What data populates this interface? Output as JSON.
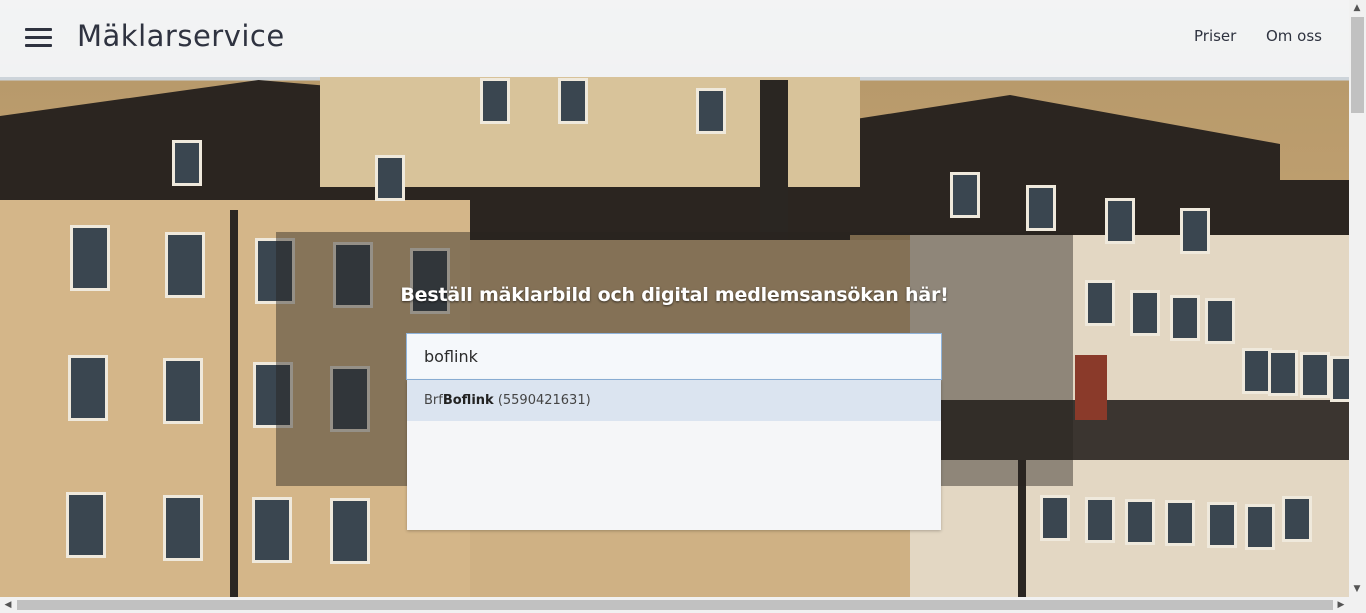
{
  "header": {
    "brand": "Mäklarservice",
    "nav": [
      {
        "label": "Priser"
      },
      {
        "label": "Om oss"
      }
    ]
  },
  "hero": {
    "headline": "Beställ mäklarbild och digital medlemsansökan här!",
    "search": {
      "value": "boflink"
    },
    "suggestions": [
      {
        "prefix": "Brf ",
        "match": "Boflink",
        "suffix": " (5590421631)"
      }
    ]
  }
}
